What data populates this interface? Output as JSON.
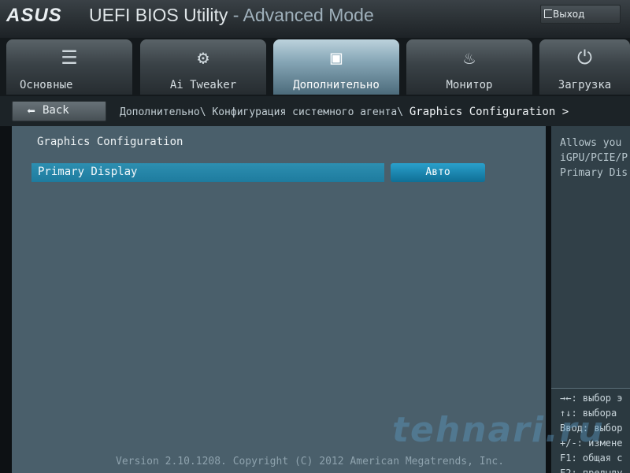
{
  "header": {
    "logo": "ASUS",
    "title_main": "UEFI BIOS Utility",
    "title_sub": " - Advanced Mode",
    "exit_label": "Выход"
  },
  "tabs": [
    {
      "label": "Основные",
      "icon": "list-icon",
      "glyph": "☰",
      "active": false
    },
    {
      "label": "Ai Tweaker",
      "icon": "tweaker-icon",
      "glyph": "⚙",
      "active": false
    },
    {
      "label": "Дополнительно",
      "icon": "advanced-info-icon",
      "glyph": "▣",
      "active": true
    },
    {
      "label": "Монитор",
      "icon": "monitor-gauge-icon",
      "glyph": "♨",
      "active": false
    },
    {
      "label": "Загрузка",
      "icon": "power-icon",
      "glyph": "⏻",
      "active": false
    }
  ],
  "nav": {
    "back_label": "Back",
    "breadcrumb_path": "Дополнительно\\ Конфигурация системного агента\\ ",
    "breadcrumb_current": "Graphics Configuration >"
  },
  "main": {
    "section_title": "Graphics Configuration",
    "setting_label": "Primary Display",
    "setting_value": "Авто",
    "version": "Version 2.10.1208. Copyright (C) 2012 American Megatrends, Inc."
  },
  "help": {
    "lines": [
      "Allows you",
      "iGPU/PCIE/P",
      "Primary Dis"
    ]
  },
  "keys": {
    "lines": [
      "→←: выбор э",
      "↑↓: выбора",
      "Ввод: выбор",
      "+/-: измене",
      "F1: общая с",
      "F2: предыду"
    ]
  },
  "watermark": "tehnari.ru",
  "colors": {
    "accent": "#1e7b9e",
    "panel": "#4a5f6b",
    "help_panel": "#314048"
  }
}
